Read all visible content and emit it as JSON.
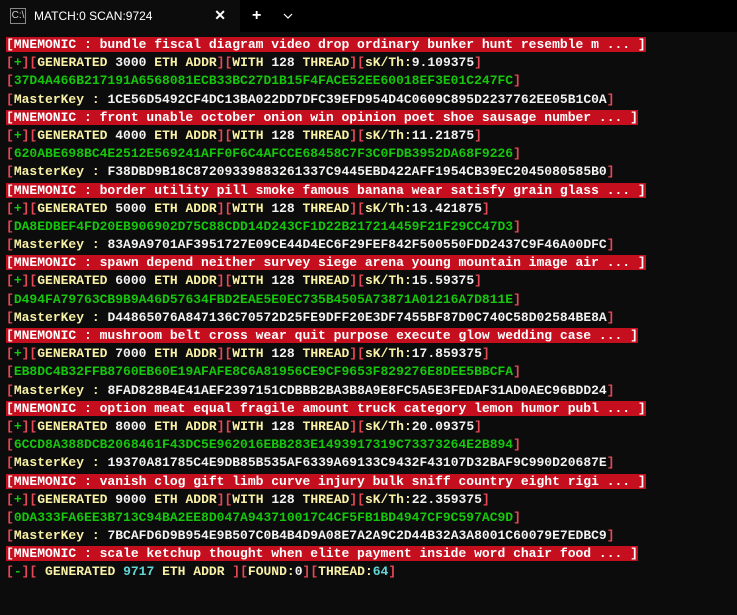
{
  "window": {
    "title": "MATCH:0 SCAN:9724"
  },
  "lines": [
    {
      "type": "mnemonic",
      "text": "[MNEMONIC : bundle fiscal diagram video drop ordinary bunker hunt resemble m ... ]"
    },
    {
      "type": "gen",
      "plus": "+",
      "g1": "GENERATED ",
      "count": "3000",
      "g2": " ETH ADDR",
      "w": "WITH ",
      "th": "128",
      "g3": " THREAD",
      "sk": "sK/Th:",
      "skv": "9.109375"
    },
    {
      "type": "hex",
      "val": "37D4A466B217191A6568081ECB33BC27D1B15F4FACE52EE60018EF3E01C247FC"
    },
    {
      "type": "master",
      "val": "1CE56D5492CF4DC13BA022DD7DFC39EFD954D4C0609C895D2237762EE05B1C0A"
    },
    {
      "type": "mnemonic",
      "text": "[MNEMONIC : front unable october onion win opinion poet shoe sausage number ... ]"
    },
    {
      "type": "gen",
      "plus": "+",
      "g1": "GENERATED ",
      "count": "4000",
      "g2": " ETH ADDR",
      "w": "WITH ",
      "th": "128",
      "g3": " THREAD",
      "sk": "sK/Th:",
      "skv": "11.21875"
    },
    {
      "type": "hex",
      "val": "620ABE698BC4E2512E569241AFF0F6C4AFCCE68458C7F3C0FDB3952DA68F9226"
    },
    {
      "type": "master",
      "val": "F38DBD9B18C87209339883261337C9445EBD422AFF1954CB39EC2045080585B0"
    },
    {
      "type": "mnemonic",
      "text": "[MNEMONIC : border utility pill smoke famous banana wear satisfy grain glass ... ]"
    },
    {
      "type": "gen",
      "plus": "+",
      "g1": "GENERATED ",
      "count": "5000",
      "g2": " ETH ADDR",
      "w": "WITH ",
      "th": "128",
      "g3": " THREAD",
      "sk": "sK/Th:",
      "skv": "13.421875"
    },
    {
      "type": "hex",
      "val": "DA8EDBEF4FD20EB906902D75C88CDD14D243CF1D22B217214459F21F29CC47D3"
    },
    {
      "type": "master",
      "val": "83A9A9701AF3951727E09CE44D4EC6F29FEF842F500550FDD2437C9F46A00DFC"
    },
    {
      "type": "mnemonic",
      "text": "[MNEMONIC : spawn depend neither survey siege arena young mountain image air ... ]"
    },
    {
      "type": "gen",
      "plus": "+",
      "g1": "GENERATED ",
      "count": "6000",
      "g2": " ETH ADDR",
      "w": "WITH ",
      "th": "128",
      "g3": " THREAD",
      "sk": "sK/Th:",
      "skv": "15.59375"
    },
    {
      "type": "hex",
      "val": "D494FA79763CB9B9A46D57634FBD2EAE5E0EC735B4505A73871A01216A7D811E"
    },
    {
      "type": "master",
      "val": "D44865076A847136C70572D25FE9DFF20E3DF7455BF87D0C740C58D02584BE8A"
    },
    {
      "type": "mnemonic",
      "text": "[MNEMONIC : mushroom belt cross wear quit purpose execute glow wedding case ... ]"
    },
    {
      "type": "gen",
      "plus": "+",
      "g1": "GENERATED ",
      "count": "7000",
      "g2": " ETH ADDR",
      "w": "WITH ",
      "th": "128",
      "g3": " THREAD",
      "sk": "sK/Th:",
      "skv": "17.859375"
    },
    {
      "type": "hex",
      "val": "EB8DC4B32FFB8760EB60E19AFAFE8C6A81956CE9CF9653F829276E8DEE5BBCFA"
    },
    {
      "type": "master",
      "val": "8FAD828B4E41AEF2397151CDBBB2BA3B8A9E8FC5A5E3FEDAF31AD0AEC96BDD24"
    },
    {
      "type": "mnemonic",
      "text": "[MNEMONIC : option meat equal fragile amount truck category lemon humor publ ... ]"
    },
    {
      "type": "gen",
      "plus": "+",
      "g1": "GENERATED ",
      "count": "8000",
      "g2": " ETH ADDR",
      "w": "WITH ",
      "th": "128",
      "g3": " THREAD",
      "sk": "sK/Th:",
      "skv": "20.09375"
    },
    {
      "type": "hex",
      "val": "6CCD8A388DCB2068461F43DC5E962016EBB283E1493917319C73373264E2B894"
    },
    {
      "type": "master",
      "val": "19370A81785C4E9DB85B535AF6339A69133C9432F43107D32BAF9C990D20687E"
    },
    {
      "type": "mnemonic",
      "text": "[MNEMONIC : vanish clog gift limb curve injury bulk sniff country eight rigi ... ]"
    },
    {
      "type": "gen",
      "plus": "+",
      "g1": "GENERATED ",
      "count": "9000",
      "g2": " ETH ADDR",
      "w": "WITH ",
      "th": "128",
      "g3": " THREAD",
      "sk": "sK/Th:",
      "skv": "22.359375"
    },
    {
      "type": "hex",
      "val": "0DA333FA6EE3B713C94BA2EE8D047A943710017C4CF5FB1BD4947CF9C597AC9D"
    },
    {
      "type": "master",
      "val": "7BCAFD6D9B954E9B507C0B4B4D9A08E7A2A9C2D44B32A3A8001C60079E7EDBC9"
    },
    {
      "type": "mnemonic",
      "text": "[MNEMONIC : scale ketchup thought when elite payment inside word chair food ... ]"
    },
    {
      "type": "summary",
      "dash": "-",
      "g": " GENERATED ",
      "count": "9717",
      "eth": " ETH ADDR ",
      "f": "FOUND:",
      "fv": "0",
      "t": "THREAD:",
      "tv": "64"
    }
  ],
  "labels": {
    "masterkey": "MasterKey : "
  }
}
